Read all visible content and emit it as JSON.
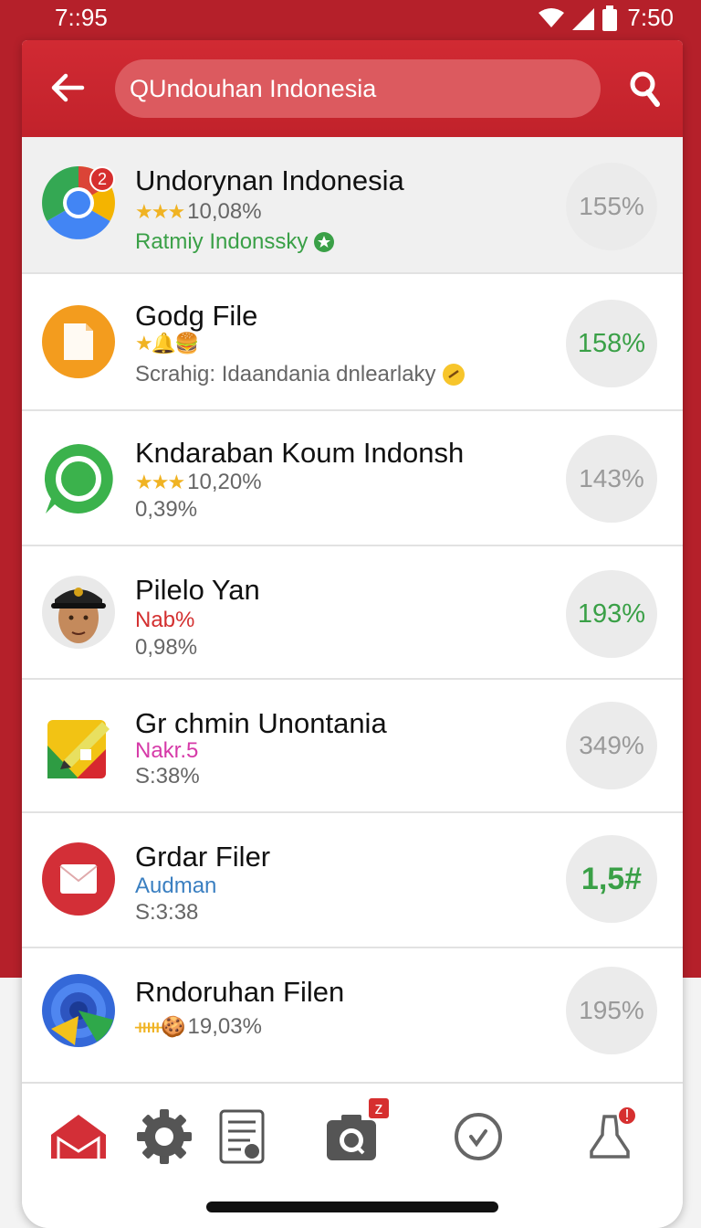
{
  "status_bar": {
    "time_left": "7::95",
    "time_right": "7:50"
  },
  "search": {
    "value": "QUndouhan Indonesia"
  },
  "colors": {
    "brand": "#c1222b",
    "accent_green": "#3aa047",
    "star": "#f0b323"
  },
  "items": [
    {
      "title": "Undorynan Indonesia",
      "rating_stars": "★★★",
      "rating_text": "10,08%",
      "subtitle": "Ratmiy Indonssky",
      "percent": "155%",
      "badge": "2",
      "icon": "chrome-app-icon"
    },
    {
      "title": "Godg File",
      "rating_stars": "★🔔🍔",
      "subtitle": "Scrahig: Idaandania dnlearlaky",
      "percent": "158%",
      "icon": "orange-file-app-icon"
    },
    {
      "title": "Kndaraban Koum Indonsh",
      "rating_stars": "★★★",
      "rating_text": "10,20%",
      "subtitle": "0,39%",
      "percent": "143%",
      "icon": "green-chat-app-icon"
    },
    {
      "title": "Pilelo Yan",
      "tag": "Nab%",
      "subtitle": "0,98%",
      "percent": "193%",
      "icon": "user-avatar"
    },
    {
      "title": "Gr chmin Unontania",
      "tag": "Nakr.5",
      "subtitle": "S:38%",
      "percent": "349%",
      "icon": "editor-app-icon"
    },
    {
      "title": "Grdar Filer",
      "tag": "Audman",
      "subtitle": "S:3:38",
      "percent": "1,5#",
      "icon": "mail-app-icon"
    },
    {
      "title": "Rndoruhan Filen",
      "rating_stars": "ᚔ🍪",
      "rating_text": "19,03%",
      "percent": "195%",
      "icon": "blue-target-app-icon"
    }
  ],
  "nav": {
    "items": [
      "home-icon",
      "settings-icon",
      "document-icon",
      "camera-search-icon",
      "clock-icon",
      "notification-user-icon"
    ],
    "camera_badge": "z",
    "user_badge": "!"
  }
}
